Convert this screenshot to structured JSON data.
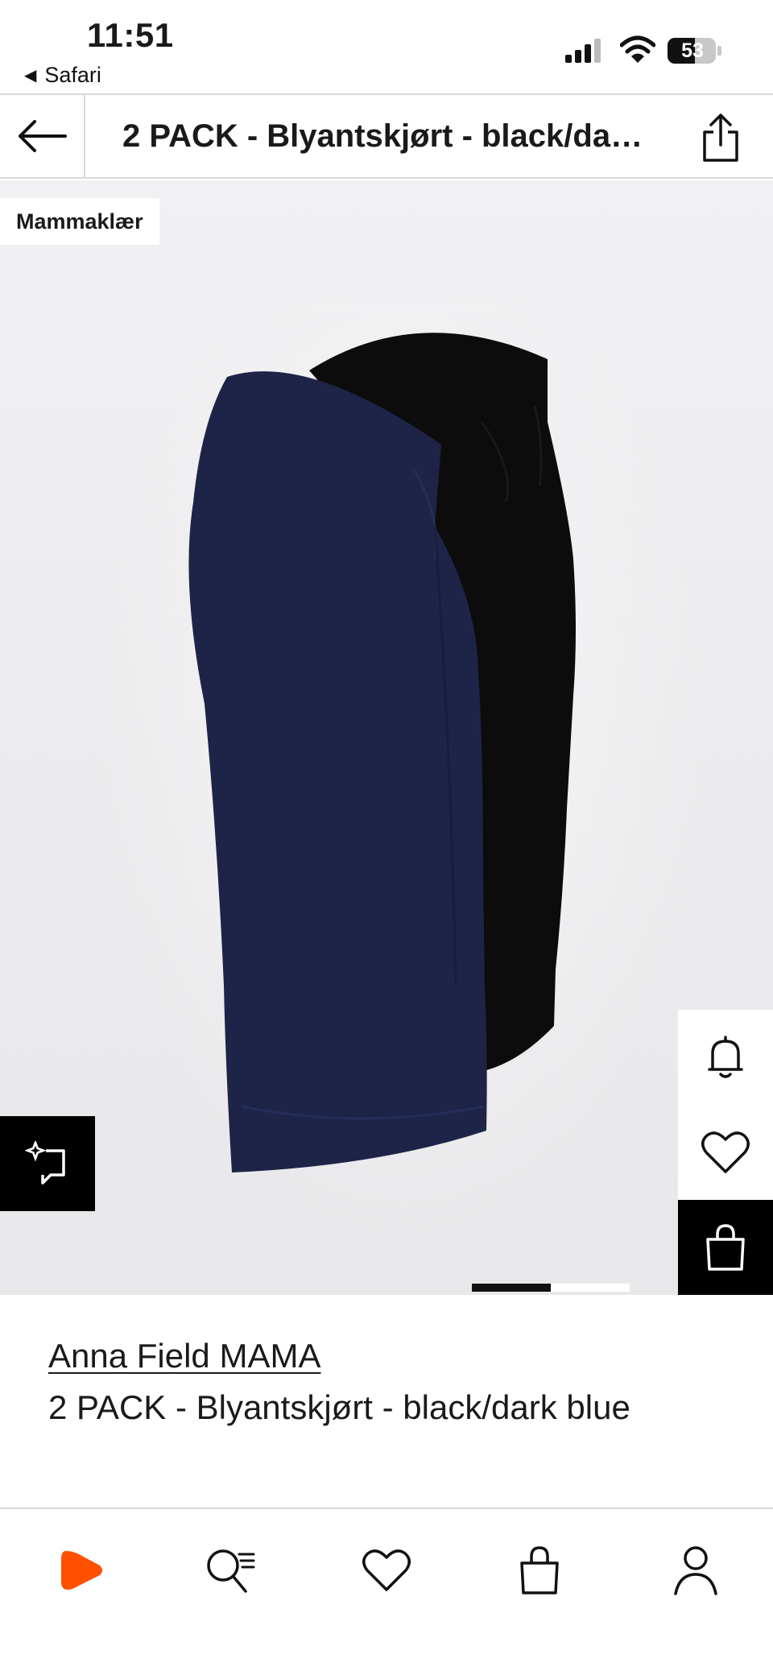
{
  "status_bar": {
    "time": "11:51",
    "back_app": "Safari",
    "battery": "53",
    "icons": [
      "signal-icon",
      "wifi-icon",
      "battery-icon"
    ]
  },
  "header": {
    "back_icon": "arrow-left-icon",
    "title": "2 PACK - Blyantskjørt - black/dark blue",
    "share_icon": "share-icon"
  },
  "image": {
    "badge": "Mammaklær",
    "try_on_icon": "sparkle-try-on-icon",
    "side_actions": [
      {
        "icon": "bell-icon"
      },
      {
        "icon": "heart-icon"
      },
      {
        "icon": "shopping-bag-icon"
      }
    ],
    "pager": {
      "pages": 2,
      "active": 1
    }
  },
  "product": {
    "brand": "Anna Field MAMA",
    "name": "2 PACK - Blyantskjørt - black/dark blue"
  },
  "tab_bar": {
    "tabs": [
      {
        "icon": "zalando-home-icon",
        "accent": "#ff4f00"
      },
      {
        "icon": "search-icon"
      },
      {
        "icon": "wishlist-heart-icon"
      },
      {
        "icon": "cart-bag-icon"
      },
      {
        "icon": "profile-icon"
      }
    ]
  },
  "colors": {
    "accent": "#ff4f00",
    "navy_skirt": "#1d2447",
    "black_skirt": "#0c0c0c"
  }
}
